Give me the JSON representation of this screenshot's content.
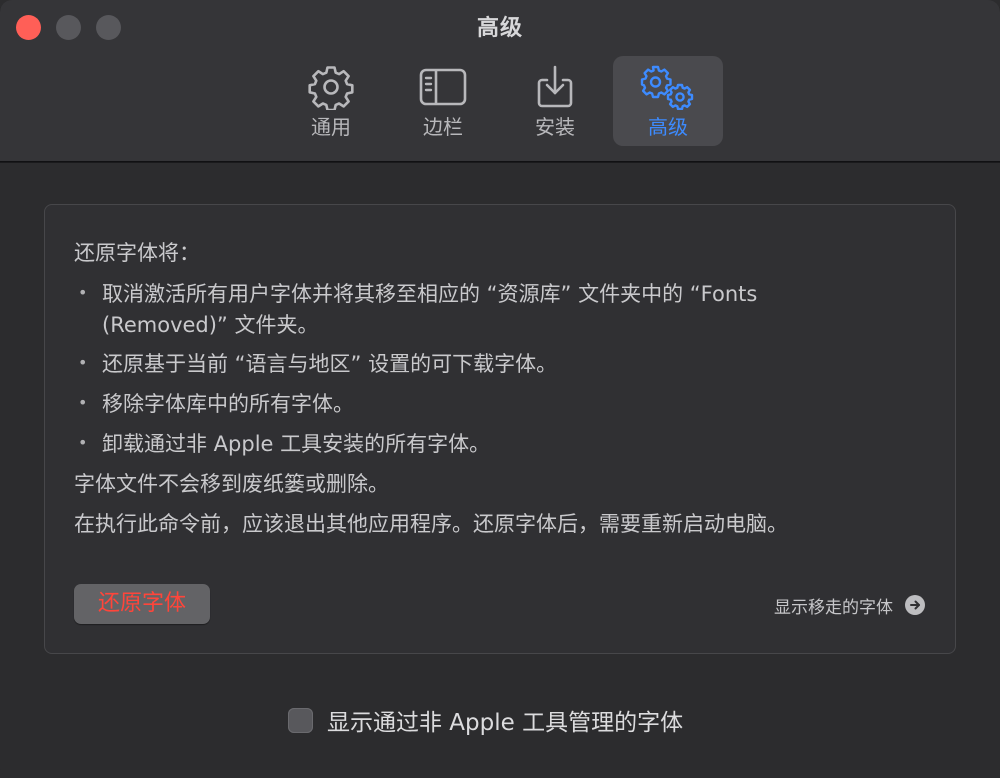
{
  "window": {
    "title": "高级"
  },
  "toolbar": {
    "tabs": [
      {
        "label": "通用",
        "icon": "gear-icon",
        "active": false
      },
      {
        "label": "边栏",
        "icon": "sidebar-icon",
        "active": false
      },
      {
        "label": "安装",
        "icon": "download-tray-icon",
        "active": false
      },
      {
        "label": "高级",
        "icon": "gears-icon",
        "active": true
      }
    ]
  },
  "panel": {
    "intro": "还原字体将：",
    "bullets": [
      "取消激活所有用户字体并将其移至相应的 “资源库” 文件夹中的 “Fonts",
      "(Removed)” 文件夹。",
      "还原基于当前 “语言与地区” 设置的可下载字体。",
      "移除字体库中的所有字体。",
      "卸载通过非 Apple 工具安装的所有字体。"
    ],
    "note1": "字体文件不会移到废纸篓或删除。",
    "note2": "在执行此命令前，应该退出其他应用程序。还原字体后，需要重新启动电脑。",
    "restore_button": "还原字体",
    "show_removed_link": "显示移走的字体"
  },
  "bottom": {
    "checkbox_label": "显示通过非 Apple 工具管理的字体",
    "checked": false
  },
  "colors": {
    "accent": "#3d8bff",
    "destructive": "#ff453a",
    "close": "#ff5f57"
  }
}
